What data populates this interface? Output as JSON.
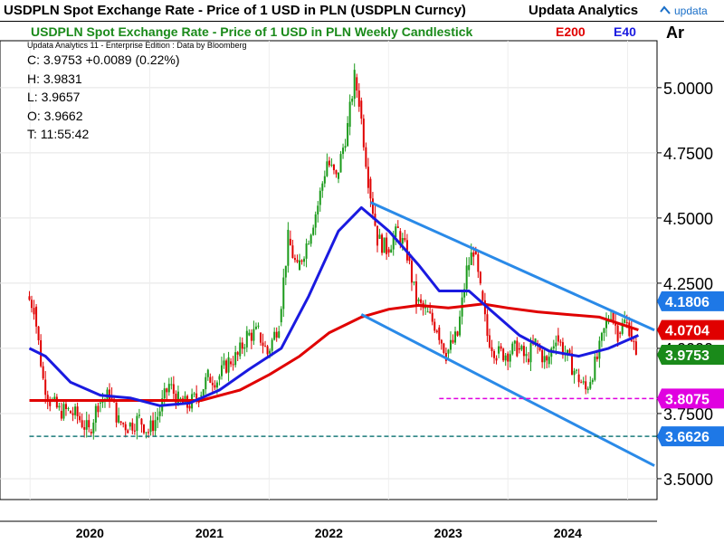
{
  "header": {
    "title": "USDPLN Spot Exchange Rate - Price of 1 USD in PLN (USDPLN Curncy)",
    "brand": "Updata Analytics",
    "logo_text": "updata",
    "axis_corner": "Ar"
  },
  "legend": {
    "subtitle": "USDPLN Spot Exchange Rate - Price of 1 USD in PLN Weekly Candlestick",
    "e200": "E200",
    "e40": "E40",
    "byline": "Updata Analytics 11 - Enterprise Edition : Data by Bloomberg"
  },
  "quote": {
    "close": "C: 3.9753  +0.0089 (0.22%)",
    "high": "H: 3.9831",
    "low": "L: 3.9657",
    "open": "O: 3.9662",
    "time": "T: 11:55:42"
  },
  "colors": {
    "candle_up": "#1a9a1a",
    "candle_down": "#e00000",
    "e200": "#e00000",
    "e40": "#1a1ae0",
    "channel": "#2a8ae8",
    "pink_level": "#e000e0",
    "teal_level": "#1a7a7a"
  },
  "chart_data": {
    "type": "candlestick",
    "title": "USDPLN Spot Exchange Rate - Price of 1 USD in PLN Weekly Candlestick",
    "x_tick_labels": [
      "2020",
      "2021",
      "2022",
      "2023",
      "2024"
    ],
    "y_tick_labels": [
      "3.5000",
      "3.7500",
      "4.0000",
      "4.2500",
      "4.5000",
      "4.7500",
      "5.0000"
    ],
    "ylim": [
      3.42,
      5.18
    ],
    "price_series": [
      [
        "2019-12-30",
        4.2
      ],
      [
        "2020-01-20",
        4.16
      ],
      [
        "2020-02-17",
        3.88
      ],
      [
        "2020-03-09",
        3.8
      ],
      [
        "2020-04-06",
        3.76
      ],
      [
        "2020-05-04",
        3.76
      ],
      [
        "2020-06-01",
        3.74
      ],
      [
        "2020-07-06",
        3.68
      ],
      [
        "2020-08-03",
        3.79
      ],
      [
        "2020-09-07",
        3.82
      ],
      [
        "2020-10-05",
        3.72
      ],
      [
        "2020-11-02",
        3.7
      ],
      [
        "2020-12-07",
        3.73
      ],
      [
        "2021-01-04",
        3.68
      ],
      [
        "2021-02-01",
        3.74
      ],
      [
        "2021-03-08",
        3.86
      ],
      [
        "2021-04-05",
        3.8
      ],
      [
        "2021-05-03",
        3.78
      ],
      [
        "2021-06-07",
        3.82
      ],
      [
        "2021-07-05",
        3.89
      ],
      [
        "2021-08-02",
        3.88
      ],
      [
        "2021-09-06",
        3.95
      ],
      [
        "2021-10-04",
        3.97
      ],
      [
        "2021-11-01",
        4.05
      ],
      [
        "2021-12-06",
        4.06
      ],
      [
        "2022-01-03",
        3.98
      ],
      [
        "2022-02-07",
        4.1
      ],
      [
        "2022-03-07",
        4.42
      ],
      [
        "2022-04-04",
        4.3
      ],
      [
        "2022-05-02",
        4.4
      ],
      [
        "2022-06-06",
        4.55
      ],
      [
        "2022-07-04",
        4.72
      ],
      [
        "2022-08-01",
        4.65
      ],
      [
        "2022-09-05",
        4.85
      ],
      [
        "2022-09-26",
        5.04
      ],
      [
        "2022-10-10",
        4.95
      ],
      [
        "2022-11-07",
        4.65
      ],
      [
        "2022-12-05",
        4.42
      ],
      [
        "2023-01-02",
        4.38
      ],
      [
        "2023-02-06",
        4.45
      ],
      [
        "2023-03-06",
        4.36
      ],
      [
        "2023-04-03",
        4.18
      ],
      [
        "2023-05-01",
        4.14
      ],
      [
        "2023-06-05",
        4.08
      ],
      [
        "2023-07-03",
        3.98
      ],
      [
        "2023-08-07",
        4.05
      ],
      [
        "2023-09-04",
        4.3
      ],
      [
        "2023-09-25",
        4.38
      ],
      [
        "2023-10-16",
        4.22
      ],
      [
        "2023-11-06",
        4.05
      ],
      [
        "2023-12-04",
        3.98
      ],
      [
        "2024-01-01",
        3.98
      ],
      [
        "2024-02-05",
        4.0
      ],
      [
        "2024-03-04",
        3.96
      ],
      [
        "2024-04-01",
        4.02
      ],
      [
        "2024-05-06",
        3.94
      ],
      [
        "2024-06-03",
        4.05
      ],
      [
        "2024-07-01",
        3.98
      ],
      [
        "2024-08-05",
        3.9
      ],
      [
        "2024-09-02",
        3.84
      ],
      [
        "2024-10-07",
        3.96
      ],
      [
        "2024-11-04",
        4.1
      ],
      [
        "2024-11-18",
        4.14
      ],
      [
        "2024-12-09",
        4.06
      ],
      [
        "2024-12-30",
        4.1
      ],
      [
        "2025-01-13",
        4.08
      ],
      [
        "2025-02-03",
        3.9753
      ]
    ],
    "series": [
      {
        "name": "E200",
        "color": "#e00000",
        "points": [
          [
            "2019-12-30",
            3.8
          ],
          [
            "2020-06-01",
            3.8
          ],
          [
            "2020-12-07",
            3.8
          ],
          [
            "2021-06-07",
            3.8
          ],
          [
            "2021-10-04",
            3.84
          ],
          [
            "2022-01-03",
            3.9
          ],
          [
            "2022-04-04",
            3.97
          ],
          [
            "2022-07-04",
            4.06
          ],
          [
            "2022-10-10",
            4.12
          ],
          [
            "2023-01-02",
            4.15
          ],
          [
            "2023-04-03",
            4.165
          ],
          [
            "2023-07-03",
            4.155
          ],
          [
            "2023-10-16",
            4.17
          ],
          [
            "2024-01-01",
            4.155
          ],
          [
            "2024-04-01",
            4.14
          ],
          [
            "2024-07-01",
            4.13
          ],
          [
            "2024-10-07",
            4.12
          ],
          [
            "2025-02-03",
            4.0704
          ]
        ]
      },
      {
        "name": "E40",
        "color": "#1a1ae0",
        "points": [
          [
            "2019-12-30",
            4.0
          ],
          [
            "2020-02-17",
            3.97
          ],
          [
            "2020-05-04",
            3.87
          ],
          [
            "2020-08-03",
            3.82
          ],
          [
            "2020-11-02",
            3.81
          ],
          [
            "2021-02-01",
            3.78
          ],
          [
            "2021-05-03",
            3.79
          ],
          [
            "2021-08-02",
            3.84
          ],
          [
            "2021-11-01",
            3.92
          ],
          [
            "2022-02-07",
            4.0
          ],
          [
            "2022-05-02",
            4.2
          ],
          [
            "2022-08-01",
            4.45
          ],
          [
            "2022-10-10",
            4.54
          ],
          [
            "2023-01-02",
            4.45
          ],
          [
            "2023-04-03",
            4.32
          ],
          [
            "2023-06-05",
            4.22
          ],
          [
            "2023-09-04",
            4.22
          ],
          [
            "2023-11-06",
            4.15
          ],
          [
            "2024-02-05",
            4.05
          ],
          [
            "2024-05-06",
            3.99
          ],
          [
            "2024-08-05",
            3.97
          ],
          [
            "2024-11-04",
            4.0
          ],
          [
            "2025-02-03",
            4.05
          ]
        ]
      }
    ],
    "channel_lines": [
      {
        "name": "upper",
        "points": [
          [
            "2022-11-07",
            4.56
          ],
          [
            "2025-03-24",
            4.07
          ]
        ]
      },
      {
        "name": "lower",
        "points": [
          [
            "2022-10-10",
            4.13
          ],
          [
            "2025-03-24",
            3.55
          ]
        ]
      }
    ],
    "horizontal_levels": [
      {
        "value": 3.8075,
        "label": "3.8075",
        "color": "#e000e0",
        "from": "2023-06-05"
      },
      {
        "value": 3.6626,
        "label": "3.6626",
        "color": "#1a7a7a",
        "from": "2019-12-30"
      }
    ],
    "price_labels": [
      {
        "value": 4.1806,
        "label": "4.1806",
        "color": "#1e78e6"
      },
      {
        "value": 4.0704,
        "label": "4.0704",
        "color": "#e00000"
      },
      {
        "value": 3.9753,
        "label": "3.9753",
        "color": "#1a8a1a"
      },
      {
        "value": 3.8075,
        "label": "3.8075",
        "color": "#e000e0"
      },
      {
        "value": 3.6626,
        "label": "3.6626",
        "color": "#1e78e6"
      }
    ],
    "grid": true
  }
}
